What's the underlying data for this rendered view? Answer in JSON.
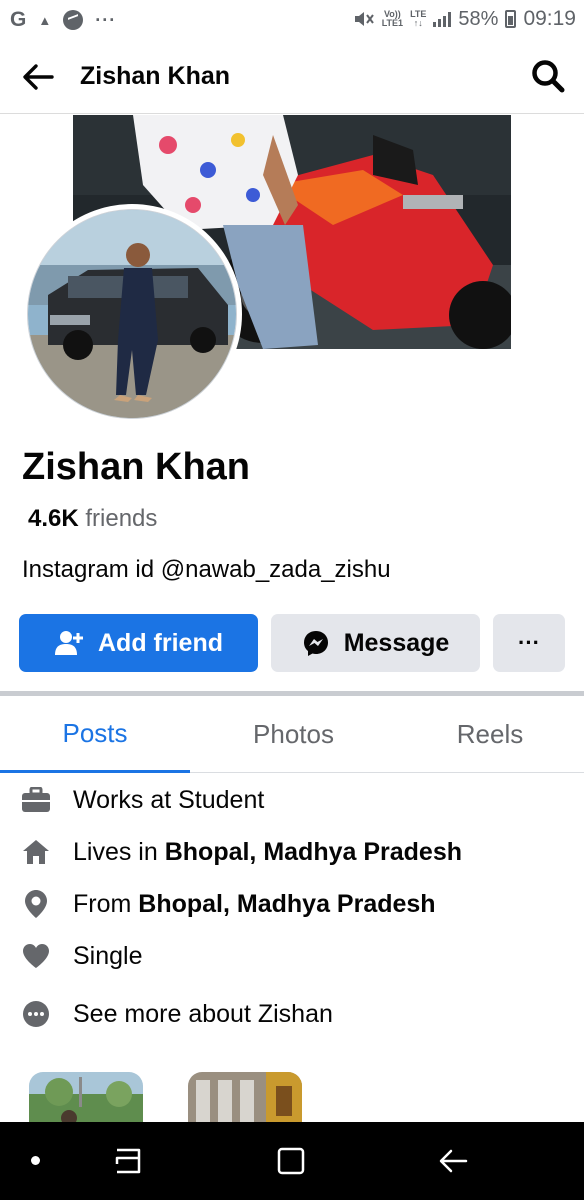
{
  "status_bar": {
    "left_icons": [
      "google-g-icon",
      "warning-icon",
      "messenger-icon",
      "more-dots-icon"
    ],
    "google_glyph": "G",
    "dots": "···",
    "volte_label_top": "Vo))",
    "volte_label_bottom": "LTE1",
    "lte_label_top": "LTE",
    "lte_label_bottom": "↑↓",
    "battery_percent": "58%",
    "time": "09:19"
  },
  "header": {
    "title": "Zishan Khan"
  },
  "profile": {
    "name": "Zishan Khan",
    "friends_count": "4.6K",
    "friends_label": " friends",
    "bio": "Instagram id @nawab_zada_zishu"
  },
  "actions": {
    "add_friend": "Add friend",
    "message": "Message",
    "more": "···"
  },
  "tabs": {
    "active": "Posts",
    "items": [
      "Posts",
      "Photos",
      "Reels"
    ]
  },
  "about": {
    "work_prefix": "Works at Student",
    "lives_prefix": "Lives in ",
    "lives_place": "Bhopal, Madhya Pradesh",
    "from_prefix": "From ",
    "from_place": "Bhopal, Madhya Pradesh",
    "relationship": "Single",
    "see_more": "See more about Zishan"
  },
  "colors": {
    "primary_blue": "#1b74e4",
    "secondary_button": "#e4e6eb",
    "text_secondary": "#65676b",
    "icon_gray": "#65676b"
  }
}
